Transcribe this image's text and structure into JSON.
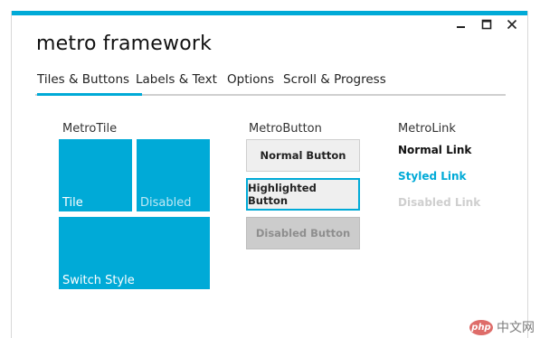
{
  "window": {
    "title": "metro framework",
    "accent_color": "#00aad7",
    "controls": [
      "minimize-icon",
      "maximize-icon",
      "close-icon"
    ]
  },
  "tabs": [
    {
      "label": "Tiles & Buttons",
      "active": true
    },
    {
      "label": "Labels & Text",
      "active": false
    },
    {
      "label": "Options",
      "active": false
    },
    {
      "label": "Scroll & Progress",
      "active": false
    }
  ],
  "sections": {
    "tile_label": "MetroTile",
    "button_label": "MetroButton",
    "link_label": "MetroLink"
  },
  "tiles": [
    {
      "label": "Tile",
      "state": "enabled"
    },
    {
      "label": "Disabled",
      "state": "disabled"
    },
    {
      "label": "Switch Style",
      "state": "enabled"
    }
  ],
  "buttons": [
    {
      "label": "Normal Button",
      "state": "normal"
    },
    {
      "label": "Highlighted Button",
      "state": "highlighted"
    },
    {
      "label": "Disabled Button",
      "state": "disabled"
    }
  ],
  "links": [
    {
      "label": "Normal Link",
      "state": "normal"
    },
    {
      "label": "Styled Link",
      "state": "styled"
    },
    {
      "label": "Disabled Link",
      "state": "disabled"
    }
  ],
  "watermark": {
    "logo": "php",
    "text": "中文网"
  }
}
